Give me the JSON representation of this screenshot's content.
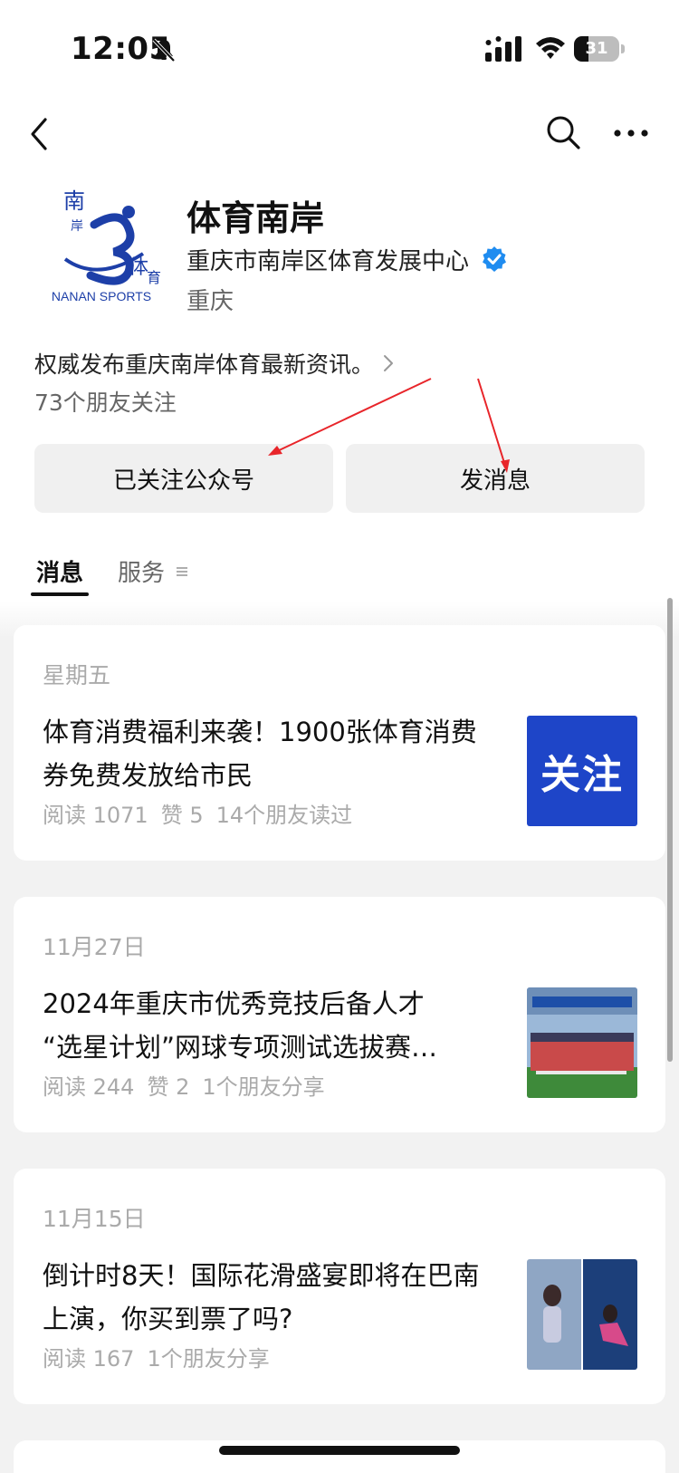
{
  "status_bar": {
    "time": "12:05",
    "battery": "31",
    "battery_level": 0.31,
    "icons": [
      "bell-muted-icon",
      "signal-icon",
      "wifi-icon",
      "battery-icon"
    ]
  },
  "nav": {
    "icons": [
      "back-icon",
      "search-icon",
      "more-icon"
    ]
  },
  "profile": {
    "logo_text": "NANAN SPORTS",
    "name": "体育南岸",
    "org": "重庆市南岸区体育发展中心",
    "location": "重庆",
    "bio": "权威发布重庆南岸体育最新资讯。",
    "friends_follow": "73个朋友关注"
  },
  "actions": {
    "follow_label": "已关注公众号",
    "message_label": "发消息"
  },
  "tabs": [
    {
      "label": "消息",
      "active": true
    },
    {
      "label": "服务",
      "active": false
    }
  ],
  "articles": [
    {
      "date": "星期五",
      "title": "体育消费福利来袭！1900张体育消费券免费发放给市民",
      "meta": [
        "阅读 1071",
        "赞 5",
        "14个朋友读过"
      ],
      "thumb_text": "关注"
    },
    {
      "date": "11月27日",
      "title_line1": "2024年重庆市优秀竞技后备人才",
      "title_line2": "“选星计划”网球专项测试选拔赛…",
      "meta": [
        "阅读 244",
        "赞 2",
        "1个朋友分享"
      ]
    },
    {
      "date": "11月15日",
      "title": "倒计时8天！国际花滑盛宴即将在巴南上演，你买到票了吗?",
      "meta": [
        "阅读 167",
        "1个朋友分享"
      ]
    }
  ],
  "colors": {
    "annotation_arrow": "#e8252a",
    "verified": "#1f8cf0",
    "thumb_blue": "#1e45c8",
    "feed_bg": "#f2f2f2"
  }
}
